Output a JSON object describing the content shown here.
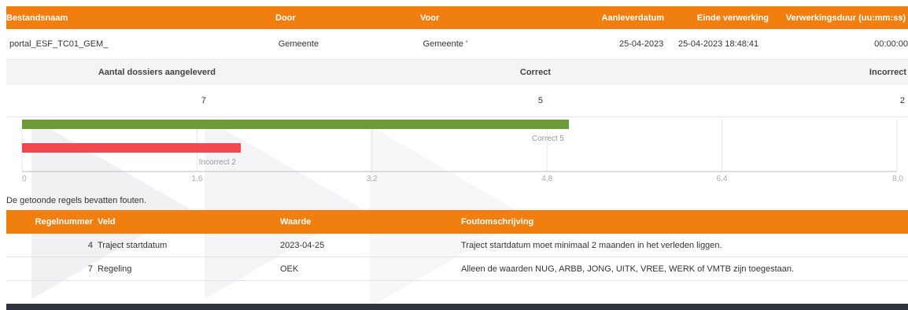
{
  "file_table": {
    "headers": [
      "Bestandsnaam",
      "Door",
      "Voor",
      "Aanleverdatum",
      "Einde verwerking",
      "Verwerkingsduur (uu:mm:ss)"
    ],
    "row": {
      "filename": "portal_ESF_TC01_GEM_",
      "door": "Gemeente",
      "voor": "Gemeente '",
      "aanleverdatum": "25-04-2023",
      "einde": "25-04-2023 18:48:41",
      "duur": "00:00:00"
    }
  },
  "summary": {
    "headers": {
      "aantal": "Aantal dossiers aangeleverd",
      "correct": "Correct",
      "incorrect": "Incorrect"
    },
    "values": {
      "aantal": "7",
      "correct": "5",
      "incorrect": "2"
    }
  },
  "chart_data": {
    "type": "bar",
    "orientation": "horizontal",
    "categories": [
      "Correct",
      "Incorrect"
    ],
    "values": [
      5,
      2
    ],
    "data_labels": [
      "Correct 5",
      "Incorrect 2"
    ],
    "colors": [
      "#6e9a3a",
      "#f0484e"
    ],
    "x_ticks": [
      "0",
      "1,6",
      "3,2",
      "4,8",
      "6,4",
      "8,0"
    ],
    "xlim": [
      0,
      8
    ],
    "grid": true
  },
  "note": "De getoonde regels bevatten fouten.",
  "errors": {
    "headers": {
      "regelnummer": "Regelnummer",
      "veld": "Veld",
      "waarde": "Waarde",
      "fout": "Foutomschrijving"
    },
    "rows": [
      {
        "regelnummer": "4",
        "veld": "Traject startdatum",
        "waarde": "2023-04-25",
        "fout": "Traject startdatum moet minimaal 2 maanden in het verleden liggen."
      },
      {
        "regelnummer": "7",
        "veld": "Regeling",
        "waarde": "OEK",
        "fout": "Alleen de waarden NUG, ARBB, JONG, UITK, VREE, WERK of VMTB zijn toegestaan."
      }
    ]
  },
  "colors": {
    "accent": "#f07f10",
    "footer": "#2e3540"
  }
}
